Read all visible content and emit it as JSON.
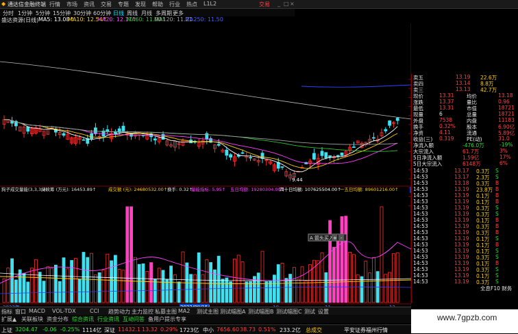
{
  "app": {
    "title": "通达信金融终端",
    "menu": [
      "行情",
      "市场",
      "资讯",
      "交易",
      "专题",
      "发现",
      "帮助",
      "行业",
      "热点",
      "L1L2"
    ],
    "exchange_label": "交易"
  },
  "period_bar": {
    "items": [
      "分时",
      "1分钟",
      "5分钟",
      "15分钟",
      "30分钟",
      "60分钟",
      "日线",
      "周线",
      "月线",
      "多周期",
      "更多"
    ],
    "selected": "日线"
  },
  "indicator_line": {
    "stock": "盛达资源(日线)",
    "ma5": "MA5: 13.08↑",
    "ma10": "MA10: 12.54↑",
    "ma20": "MA20: 12.17↑",
    "ma60": "MA60: 11.00↑",
    "ma120": "MA120: 11.21",
    "ma250": "MA250: 11.50"
  },
  "price_axis": [
    "12.80",
    "12.50",
    "12.25",
    "12.00",
    "11.75",
    "11.50",
    "11.25",
    "11.00",
    "10.75",
    "10.50",
    "10.25",
    "10.00",
    "9.75",
    "9.50",
    "9.25"
  ],
  "low_label": "9.44",
  "volume_header": {
    "name": "狗子成交量能(3,3,3,2)",
    "a": "持续筹 (万元): 16453.89↑",
    "b": "成交额 (元): 24680532.00↑",
    "c": "换手: 0.32↑",
    "d": "量能指标: 5.95↑",
    "e": "五日均额: 19280304.00↑",
    "f": "四十日均额: 107625504.00↑",
    "g": "一五日均额: 89601216.00↑"
  },
  "volume_axis": [
    "37690",
    "35000",
    "30000",
    "25000",
    "20000",
    "15000",
    "10000",
    "5000"
  ],
  "date_axis": {
    "year": "2022年",
    "date": "2022/08/15/一",
    "m9": "9",
    "m10": "10",
    "m11": "11",
    "m12": "12"
  },
  "popup": {
    "label": "A 箭头买入",
    "btn": "+",
    "btn2": "-"
  },
  "quote": {
    "sell": [
      {
        "l": "卖五",
        "p": "13.19",
        "v": "22.6万"
      },
      {
        "l": "卖四",
        "p": "13.14",
        "v": "8.8万"
      },
      {
        "l": "卖三",
        "p": "13.13",
        "v": "42.7万"
      }
    ],
    "stats": [
      {
        "l": "现价",
        "v": "13.31",
        "l2": "均价",
        "v2": "13.18"
      },
      {
        "l": "涨跌",
        "v": "13.37",
        "l2": "量比",
        "v2": "0.96"
      },
      {
        "l": "最低",
        "v": "13.31",
        "l2": "市值",
        "v2": "18721"
      },
      {
        "l": "现量",
        "v": "6",
        "l2": "总量",
        "v2": "18721"
      },
      {
        "l": "外盘",
        "v": "7538",
        "l2": "内盘",
        "v2": "11183"
      },
      {
        "l": "换手",
        "v": "0.32%",
        "l2": "股本",
        "v2": "6.90亿"
      },
      {
        "l": "净资",
        "v": "4.11",
        "l2": "流通",
        "v2": "5.89亿"
      },
      {
        "l": "收益(三)",
        "v": "0.319",
        "l2": "PE(动)",
        "v2": "31.0"
      }
    ],
    "flows": [
      {
        "l": "净流入额",
        "v": "-476.0万",
        "p": "-19%"
      },
      {
        "l": "大宗流入",
        "v": "61.7万",
        "p": "3%"
      },
      {
        "l": "5日净流入额",
        "v": "1.59亿",
        "p": "17%"
      },
      {
        "l": "5日大宗流入",
        "v": "6148万",
        "p": "6%"
      }
    ],
    "ticks": [
      {
        "t": "14:53",
        "p": "13.17",
        "v": "0.3万",
        "s": "S"
      },
      {
        "t": "14:53",
        "p": "13.17",
        "v": "2.3万",
        "s": "S"
      },
      {
        "t": "14:53",
        "p": "13.18",
        "v": "0.3万",
        "s": "B"
      },
      {
        "t": "14:53",
        "p": "13.19",
        "v": "23.8万",
        "s": "B"
      },
      {
        "t": "14:53",
        "p": "13.19",
        "v": "0.1万",
        "s": "B"
      },
      {
        "t": "14:53",
        "p": "13.19",
        "v": "0.1万",
        "s": "B"
      },
      {
        "t": "14:53",
        "p": "13.19",
        "v": "0.3万",
        "s": "S"
      },
      {
        "t": "14:53",
        "p": "13.19",
        "v": "0.3万",
        "s": "S"
      },
      {
        "t": "14:53",
        "p": "13.19",
        "v": "0.1万",
        "s": "B"
      },
      {
        "t": "14:53",
        "p": "13.19",
        "v": "0.3万",
        "s": "B"
      },
      {
        "t": "14:53",
        "p": "13.19",
        "v": "0.3万",
        "s": "B"
      },
      {
        "t": "14:53",
        "p": "13.19",
        "v": "0.1万",
        "s": "S"
      },
      {
        "t": "14:53",
        "p": "13.19",
        "v": "0.1万",
        "s": "B"
      },
      {
        "t": "14:53",
        "p": "13.19",
        "v": "0.1万",
        "s": "S"
      },
      {
        "t": "14:53",
        "p": "13.19",
        "v": "0.3万",
        "s": "S"
      },
      {
        "t": "14:53",
        "p": "13.19",
        "v": "0.1万",
        "s": "B"
      },
      {
        "t": "14:53",
        "p": "13.19",
        "v": "0.3万",
        "s": "S"
      },
      {
        "t": "14:53",
        "p": "13.19",
        "v": "0.1万",
        "s": "S"
      },
      {
        "t": "14:53",
        "p": "13.19",
        "v": "0.3万",
        "s": "S"
      }
    ],
    "footer": "全息F10 财务"
  },
  "tabs": [
    "指标",
    "窗口",
    "MACD",
    "VOL-TDX",
    "CCI",
    "趋势动力",
    "主力监控",
    "私募主图",
    "MA2",
    "测试主图",
    "测试幅图A",
    "测试幅图B",
    "测试幅图C",
    "测试",
    "设置"
  ],
  "tabs2": [
    "扩展▲",
    "关联板块",
    "资金分布",
    "综合资讯",
    "行业资讯",
    "互动问答",
    "备用户提示专享"
  ],
  "status": {
    "sh_name": "上证",
    "sh_v": "3204.47",
    "sh_c": "-0.06",
    "sh_p": "-0.25%",
    "sh_amt": "1114亿",
    "sz_name": "深证",
    "sz_v": "11432.1",
    "sz_c": "13.32",
    "sz_p": "0.29%",
    "sz_amt": "1723亿",
    "zx_name": "中小",
    "zx_v": "7656.60",
    "zx_c": "38.73",
    "zx_p": "0.51%",
    "zx_amt": "233.2亿",
    "hq": "总成交",
    "broker": "平安证券福州行情"
  },
  "watermark": "www.7gpzb.com",
  "colors": {
    "up": "#ff3030",
    "down": "#40e0f0",
    "ma5": "#ffffff",
    "ma10": "#ffd000",
    "ma20": "#ff40ff",
    "ma60": "#30c030",
    "ma120": "#a0a0a0"
  }
}
